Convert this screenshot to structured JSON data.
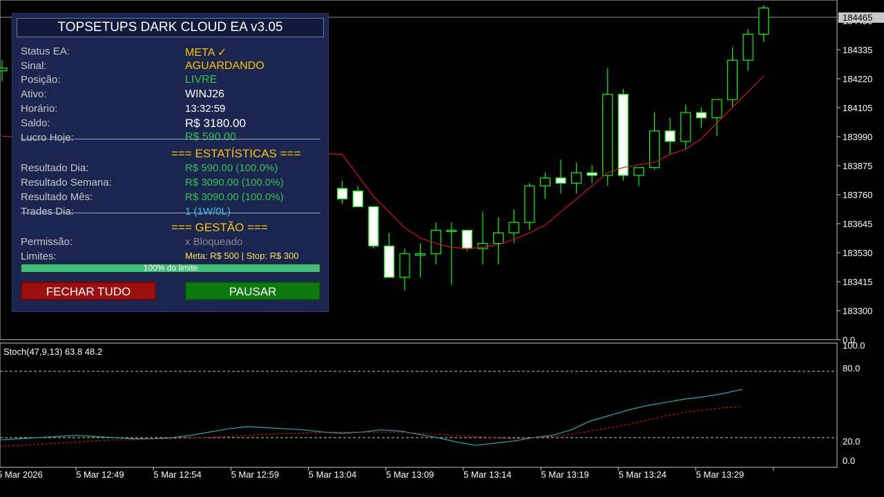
{
  "panel": {
    "title": "TOPSETUPS DARK CLOUD EA v3.05",
    "rows": [
      {
        "label": "Status EA:",
        "value": "META ✓",
        "color": "#ffc200"
      },
      {
        "label": "Sinal:",
        "value": "AGUARDANDO",
        "color": "#ffc200"
      },
      {
        "label": "Posição:",
        "value": "LIVRE",
        "color": "#36c24e"
      },
      {
        "label": "Ativo:",
        "value": "WINJ26",
        "color": "#ffffff"
      },
      {
        "label": "Horário:",
        "value": "13:32:59",
        "color": "#ffffff"
      },
      {
        "label": "Saldo:",
        "value": "R$ 3180.00",
        "color": "#ffffff"
      },
      {
        "label": "Lucro Hoje:",
        "value": "R$ 590.00",
        "color": "#36c24e"
      }
    ],
    "stats_header": "=== ESTATÍSTICAS ===",
    "stats": [
      {
        "label": "Resultado Dia:",
        "value": "R$ 590.00 (100.0%)",
        "color": "#36c24e"
      },
      {
        "label": "Resultado Semana:",
        "value": "R$ 3090.00 (100.0%)",
        "color": "#36c24e"
      },
      {
        "label": "Resultado Mês:",
        "value": "R$ 3090.00 (100.0%)",
        "color": "#36c24e"
      },
      {
        "label": "Trades Dia:",
        "value": "1 (1W/0L)",
        "color": "#2ec6e6"
      }
    ],
    "gestao_header": "=== GESTÃO ===",
    "permissao_label": "Permissão:",
    "permissao_value": "x Bloqueado",
    "limites_label": "Limites:",
    "limites_value": "Meta: R$ 500 | Stop: R$ 300",
    "progress_text": "100% do limite",
    "progress": 1.0,
    "btn_close": "FECHAR TUDO",
    "btn_pause": "PAUSAR"
  },
  "price_axis": {
    "current_price": "184465",
    "ticks": [
      "184450",
      "184335",
      "184220",
      "184105",
      "183990",
      "183875",
      "183760",
      "183645",
      "183530",
      "183415",
      "183300",
      "0.0"
    ]
  },
  "indicator": {
    "label": "Stoch(47,9,13) 63.8 48.2",
    "ticks": [
      "100.0",
      "80.0",
      "20.0",
      "0.0"
    ],
    "main": [
      18,
      19,
      20,
      21,
      22,
      21,
      20,
      19,
      19,
      20,
      22,
      25,
      28,
      30,
      29,
      28,
      27,
      25,
      24,
      25,
      27,
      26,
      23,
      20,
      16,
      13,
      15,
      17,
      20,
      22,
      27,
      35,
      40,
      45,
      49,
      52,
      55,
      57,
      60,
      63.8
    ],
    "signal": [
      12,
      13,
      14,
      15,
      16,
      17,
      18,
      18,
      19,
      19,
      20,
      20,
      21,
      22,
      23,
      24,
      24,
      25,
      25,
      25,
      25,
      25,
      24,
      23,
      22,
      21,
      20,
      19,
      20,
      21,
      23,
      26,
      29,
      32,
      36,
      40,
      43,
      45,
      47,
      48.2
    ]
  },
  "time_axis": [
    "5 Mar 2026",
    "5 Mar 12:49",
    "5 Mar 12:54",
    "5 Mar 12:59",
    "5 Mar 13:04",
    "5 Mar 13:09",
    "5 Mar 13:14",
    "5 Mar 13:19",
    "5 Mar 13:24",
    "5 Mar 13:29"
  ],
  "chart_data": {
    "type": "candlestick",
    "ylim": [
      183250,
      184480
    ],
    "candles": [
      [
        184220,
        184260,
        184180,
        184230
      ],
      [
        183770,
        183800,
        183710,
        183730
      ],
      [
        183760,
        183780,
        183700,
        183700
      ],
      [
        183700,
        183700,
        183540,
        183550
      ],
      [
        183550,
        183600,
        183430,
        183430
      ],
      [
        183430,
        183540,
        183380,
        183520
      ],
      [
        183520,
        183560,
        183430,
        183520
      ],
      [
        183520,
        183640,
        183480,
        183610
      ],
      [
        183610,
        183640,
        183400,
        183610
      ],
      [
        183610,
        183610,
        183530,
        183540
      ],
      [
        183540,
        183680,
        183480,
        183560
      ],
      [
        183560,
        183660,
        183480,
        183600
      ],
      [
        183600,
        183690,
        183560,
        183640
      ],
      [
        183640,
        183790,
        183610,
        183780
      ],
      [
        183780,
        183830,
        183730,
        183810
      ],
      [
        183810,
        183880,
        183750,
        183790
      ],
      [
        183790,
        183870,
        183750,
        183830
      ],
      [
        183830,
        183860,
        183790,
        183820
      ],
      [
        183820,
        184230,
        183780,
        184130
      ],
      [
        184130,
        184150,
        183800,
        183820
      ],
      [
        183820,
        183850,
        183780,
        183850
      ],
      [
        183850,
        184060,
        183840,
        183990
      ],
      [
        183990,
        184040,
        183900,
        183950
      ],
      [
        183950,
        184090,
        183920,
        184060
      ],
      [
        184060,
        184080,
        184000,
        184040
      ],
      [
        184040,
        184110,
        183970,
        184110
      ],
      [
        184110,
        184310,
        184080,
        184260
      ],
      [
        184260,
        184380,
        184220,
        184360
      ],
      [
        184360,
        184470,
        184330,
        184460
      ]
    ],
    "ma": [
      183970,
      183900,
      183820,
      183740,
      183680,
      183620,
      183580,
      183560,
      183545,
      183540,
      183545,
      183555,
      183575,
      183600,
      183630,
      183680,
      183730,
      183780,
      183830,
      183850,
      183860,
      183870,
      183900,
      183920,
      183960,
      184020,
      184080,
      184140,
      184200
    ]
  }
}
